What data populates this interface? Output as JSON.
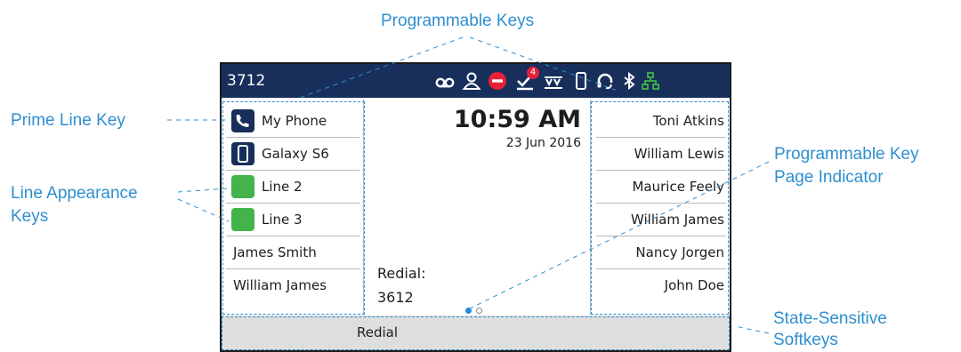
{
  "callouts": {
    "programmable_keys": "Programmable Keys",
    "prime_line_key": "Prime Line Key",
    "line_appearance_1": "Line Appearance",
    "line_appearance_2": "Keys",
    "page_indicator_1": "Programmable Key",
    "page_indicator_2": "Page Indicator",
    "softkeys_1": "State-Sensitive",
    "softkeys_2": "Softkeys"
  },
  "status_bar": {
    "extension": "3712",
    "message_badge": "4",
    "icons": [
      "voicemail-icon",
      "user-presence-icon",
      "do-not-disturb-icon",
      "messages-icon",
      "call-forward-icon",
      "mobile-phone-icon",
      "headset-icon",
      "bluetooth-icon",
      "network-icon"
    ]
  },
  "line_keys": [
    {
      "label": "My Phone",
      "icon": "phone-icon"
    },
    {
      "label": "Galaxy S6",
      "icon": "mobile-phone-icon"
    },
    {
      "label": "Line 2",
      "icon": "line-status-icon"
    },
    {
      "label": "Line 3",
      "icon": "line-status-icon"
    },
    {
      "label": "James Smith"
    },
    {
      "label": "William James"
    }
  ],
  "clock": {
    "time": "10:59 AM",
    "date": "23 Jun 2016"
  },
  "redial": {
    "label": "Redial:",
    "number": "3612"
  },
  "programmable_keys": [
    "Toni Atkins",
    "William Lewis",
    "Maurice Feely",
    "William James",
    "Nancy Jorgen",
    "John Doe"
  ],
  "page_indicator": {
    "current": 1,
    "total": 2
  },
  "softkeys": {
    "redial": "Redial"
  },
  "colors": {
    "topbar": "#172f5a",
    "callout": "#2f8fcf",
    "line_green": "#43b34a",
    "icon_navy": "#172f5a",
    "dnd_red": "#e8203a",
    "network_green": "#41b549",
    "softkey_bar": "#dedede"
  }
}
